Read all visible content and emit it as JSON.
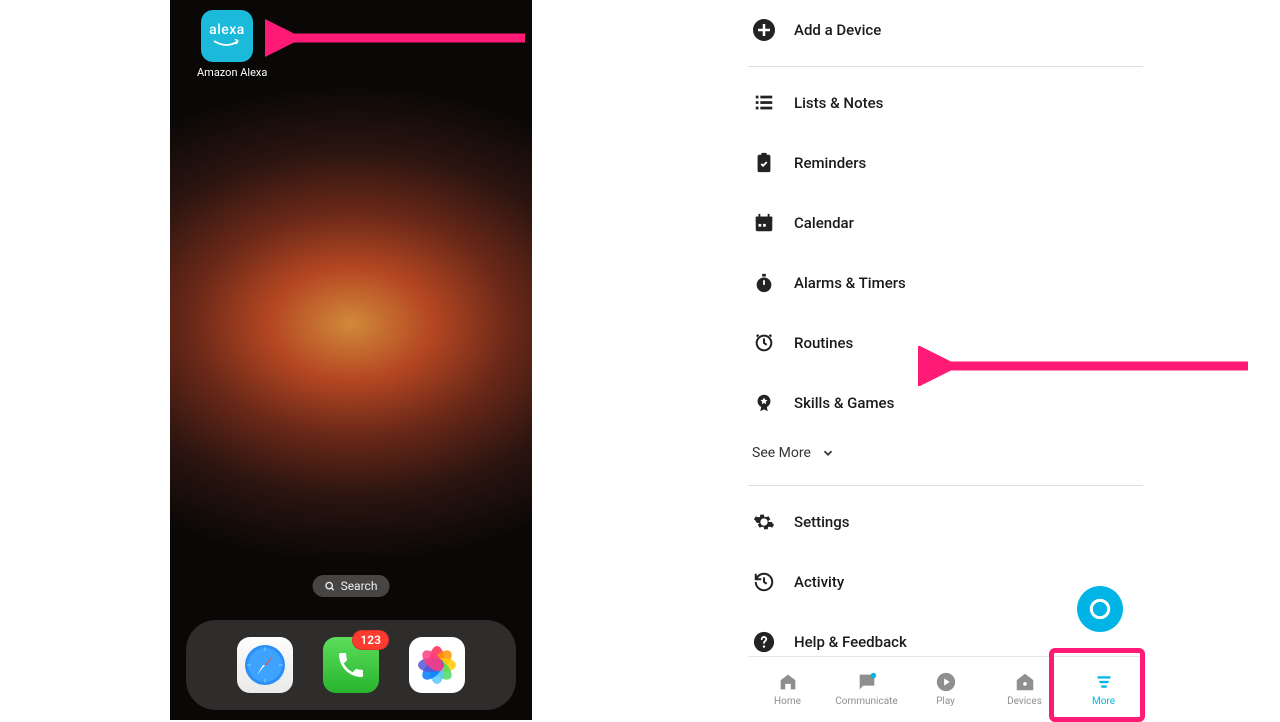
{
  "left": {
    "alexa_word": "alexa",
    "alexa_label": "Amazon Alexa",
    "search_label": "Search",
    "badge_count": "123"
  },
  "menu": {
    "add_device": "Add a Device",
    "lists": "Lists & Notes",
    "reminders": "Reminders",
    "calendar": "Calendar",
    "alarms": "Alarms & Timers",
    "routines": "Routines",
    "skills": "Skills & Games",
    "see_more": "See More",
    "settings": "Settings",
    "activity": "Activity",
    "help": "Help & Feedback"
  },
  "tabs": {
    "home": "Home",
    "communicate": "Communicate",
    "play": "Play",
    "devices": "Devices",
    "more": "More"
  }
}
